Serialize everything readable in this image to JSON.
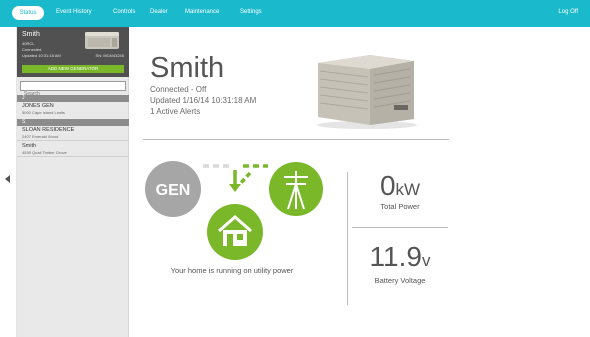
{
  "nav": {
    "tabs": [
      {
        "label": "Status"
      },
      {
        "label": "Event History"
      },
      {
        "label": "Controls"
      },
      {
        "label": "Dealer"
      },
      {
        "label": "Maintenance"
      },
      {
        "label": "Settings"
      }
    ],
    "logoff": "Log Off",
    "accent_color": "#1ab9cb"
  },
  "sidebar": {
    "selected": {
      "name": "Smith",
      "model": "40RCL",
      "connection": "Connected",
      "updated": "Updated 10:31:18 AM",
      "serial": "SN: MCM43245"
    },
    "add_button": "ADD NEW GENERATOR",
    "search_placeholder": "Search",
    "groups": [
      {
        "header": "J",
        "items": [
          {
            "name": "JONES GEN",
            "address": "5000 Cape Island Limits"
          }
        ]
      },
      {
        "header": "S",
        "items": [
          {
            "name": "SLOAN RESIDENCE",
            "address": "2407 Emerald Wood"
          },
          {
            "name": "Smith",
            "address": "4539 Quail Timber Grove"
          }
        ]
      }
    ]
  },
  "main": {
    "title": "Smith",
    "connection": "Connected - Off",
    "updated": "Updated 1/16/14 10:31:18 AM",
    "alerts": "1 Active Alerts",
    "diagram": {
      "gen_label": "GEN",
      "caption": "Your home is running on utility power",
      "gen_color": "#a6a6a6",
      "active_color": "#7ab829"
    },
    "power": {
      "value": "0",
      "unit": "kW",
      "label": "Total Power"
    },
    "battery": {
      "value": "11.9",
      "unit": "v",
      "label": "Battery Voltage"
    }
  }
}
